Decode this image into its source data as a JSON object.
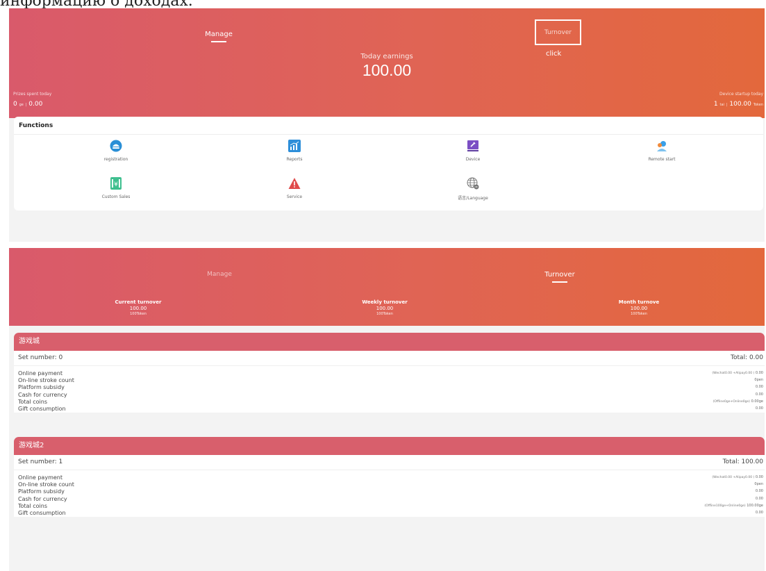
{
  "caption": "информацию о доходах.",
  "screen1": {
    "tabs": {
      "manage": "Manage",
      "turnover": "Turnover"
    },
    "click_label": "click",
    "today_earnings_label": "Today earnings",
    "today_earnings_value": "100.00",
    "prizes": {
      "label": "Prizes spent today",
      "count": "0",
      "unit": "ge",
      "sep": "|",
      "amount": "0.00"
    },
    "device": {
      "label": "Device startup today",
      "count": "1",
      "unit": "tai",
      "sep": "|",
      "amount": "100.00",
      "token_unit": "Token"
    },
    "functions": {
      "title": "Functions",
      "items": [
        {
          "label": "registration",
          "icon": "registration-icon",
          "color": "#2a8fd6"
        },
        {
          "label": "Reports",
          "icon": "reports-icon",
          "color": "#2d8ed9"
        },
        {
          "label": "Device",
          "icon": "device-icon",
          "color": "#7b4fc4"
        },
        {
          "label": "Remote start",
          "icon": "remote-start-icon",
          "color": "#3aa0e8"
        },
        {
          "label": "Custom Sales",
          "icon": "custom-sales-icon",
          "color": "#3fbf8f"
        },
        {
          "label": "Service",
          "icon": "service-icon",
          "color": "#e04b4b"
        },
        {
          "label": "语言/Language",
          "icon": "language-icon",
          "color": "#777777"
        }
      ]
    }
  },
  "screen2": {
    "tabs": {
      "manage": "Manage",
      "turnover": "Turnover"
    },
    "stats": [
      {
        "label": "Current turnover",
        "value": "100.00",
        "token": "100Token"
      },
      {
        "label": "Weekly turnover",
        "value": "100.00",
        "token": "100Token"
      },
      {
        "label": "Month turnove",
        "value": "100.00",
        "token": "100Token"
      }
    ],
    "shops": [
      {
        "name": "游戏城",
        "set_number": "Set number: 0",
        "total": "Total: 0.00",
        "rows": [
          {
            "label": "Online payment",
            "note": "(Wechat0.00 +Alipay0.00 )",
            "value": "0.00"
          },
          {
            "label": "On-line stroke count",
            "note": "",
            "value": "0pen"
          },
          {
            "label": "Platform subsidy",
            "note": "",
            "value": "0.00"
          },
          {
            "label": "Cash for currency",
            "note": "",
            "value": "0.00"
          },
          {
            "label": "Total coins",
            "note": "(Offline0ge+Online0ge)",
            "value": "0.00ge"
          },
          {
            "label": "Gift consumption",
            "note": "",
            "value": "0.00"
          }
        ]
      },
      {
        "name": "游戏城2",
        "set_number": "Set number: 1",
        "total": "Total: 100.00",
        "rows": [
          {
            "label": "Online payment",
            "note": "(Wechat0.00 +Alipay0.00 )",
            "value": "0.00"
          },
          {
            "label": "On-line stroke count",
            "note": "",
            "value": "0pen"
          },
          {
            "label": "Platform subsidy",
            "note": "",
            "value": "0.00"
          },
          {
            "label": "Cash for currency",
            "note": "",
            "value": "0.00"
          },
          {
            "label": "Total coins",
            "note": "(Offline100ge+Online0ge)",
            "value": "100.00ge"
          },
          {
            "label": "Gift consumption",
            "note": "",
            "value": "0.00"
          }
        ]
      }
    ]
  }
}
